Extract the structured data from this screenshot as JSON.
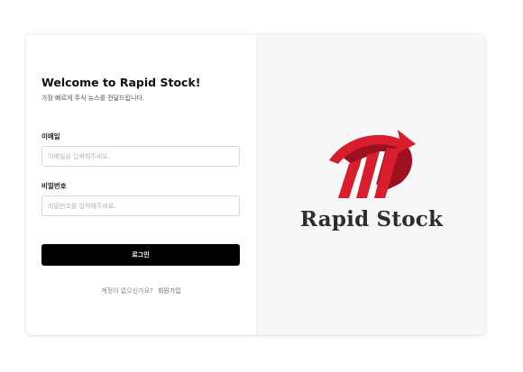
{
  "login": {
    "title": "Welcome to Rapid Stock!",
    "subtitle": "가장 빠르게 주식 뉴스를 전달드립니다.",
    "email_label": "이메일",
    "email_placeholder": "이메일을 입력해주세요.",
    "email_value": "",
    "password_label": "비밀번호",
    "password_placeholder": "비밀번호를 입력해주세요.",
    "password_value": "",
    "login_button_label": "로그인",
    "signup_prompt": "계정이 없으신가요?",
    "signup_link": "회원가입"
  },
  "brand": {
    "name": "Rapid Stock",
    "logo_icon": "rapid-stock-logo-icon",
    "colors": {
      "primary_red": "#d81e2c",
      "dark_red": "#9c1020",
      "text": "#2d2d2d"
    }
  },
  "theme": {
    "button_bg": "#000000",
    "panel_bg": "#f7f7f9"
  }
}
